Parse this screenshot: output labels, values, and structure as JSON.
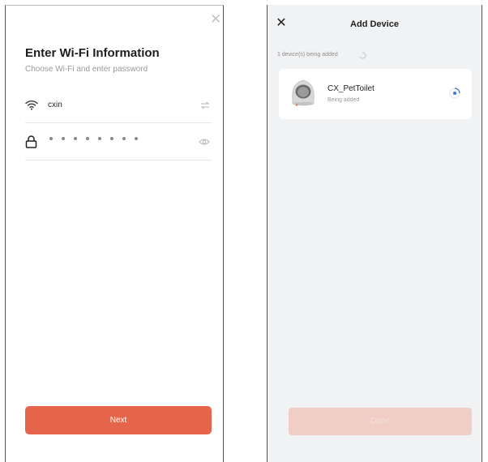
{
  "wifi_screen": {
    "close_icon": "close-icon",
    "title": "Enter Wi-Fi Information",
    "subtitle": "Choose Wi-Fi and enter password",
    "ssid": "cxin",
    "ssid_icon": "wifi-icon",
    "switch_icon": "switch-network-icon",
    "password_icon": "lock-icon",
    "password_masked_length": 8,
    "visibility_icon": "eye-icon",
    "next_label": "Next"
  },
  "add_device_screen": {
    "close_icon": "close-icon",
    "title": "Add Device",
    "adding_status": "1 device(s) being added",
    "device": {
      "name": "CX_PetToilet",
      "status": "Being added"
    },
    "done_label": "Done"
  },
  "colors": {
    "accent": "#e5654a",
    "accent_disabled": "#f0cdc5",
    "progress": "#2f6fd6",
    "panel_background": "#f1f2f4"
  }
}
